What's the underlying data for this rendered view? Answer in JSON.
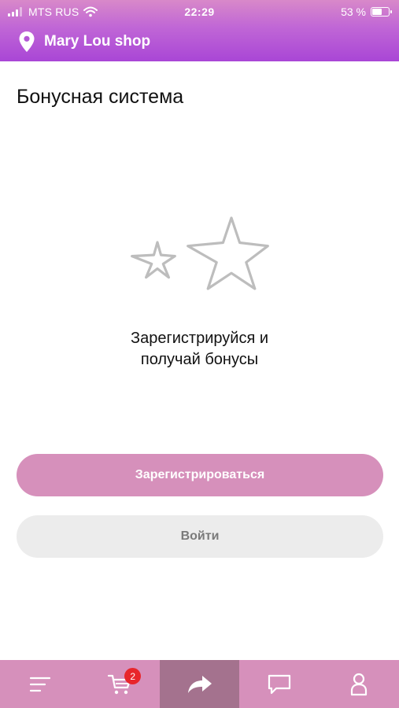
{
  "status_bar": {
    "carrier": "MTS RUS",
    "time": "22:29",
    "battery_percent": "53 %",
    "battery_level": 0.53
  },
  "header": {
    "shop_name": "Mary Lou shop",
    "location_icon": "map-pin-icon"
  },
  "page": {
    "title": "Бонусная система",
    "illustration_icon": "stars-outline-icon",
    "promo_line1": "Зарегистрируйся и",
    "promo_line2": "получай бонусы"
  },
  "actions": {
    "register_label": "Зарегистрироваться",
    "login_label": "Войти"
  },
  "tab_bar": {
    "items": [
      {
        "icon": "menu-icon"
      },
      {
        "icon": "cart-icon",
        "badge": "2"
      },
      {
        "icon": "share-arrow-icon",
        "active": true
      },
      {
        "icon": "chat-icon"
      },
      {
        "icon": "profile-icon"
      }
    ]
  },
  "colors": {
    "header_gradient_top": "#d889c9",
    "header_gradient_bottom": "#a946d6",
    "accent_pink": "#d690bb",
    "active_tab": "#a4728e",
    "secondary_button": "#ececec",
    "badge_red": "#e8262b"
  }
}
